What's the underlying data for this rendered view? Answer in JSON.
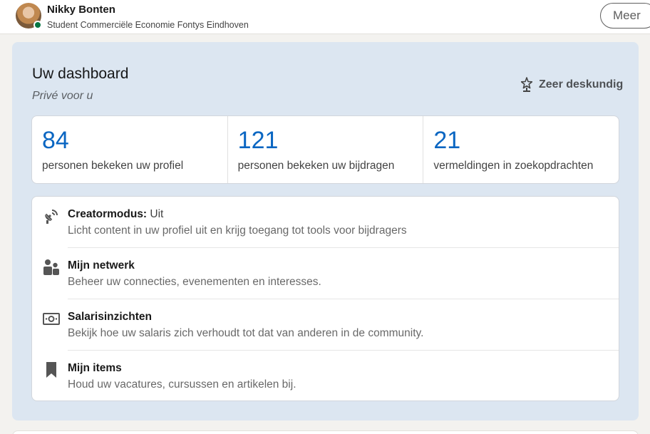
{
  "profile": {
    "name": "Nikky Bonten",
    "headline": "Student Commerciële Economie Fontys Eindhoven",
    "more_label": "Meer"
  },
  "dashboard": {
    "title": "Uw dashboard",
    "subtitle": "Privé voor u",
    "expert_label": "Zeer deskundig",
    "stats": [
      {
        "value": "84",
        "label": "personen bekeken uw profiel"
      },
      {
        "value": "121",
        "label": "personen bekeken uw bijdragen"
      },
      {
        "value": "21",
        "label": "vermeldingen in zoekopdrachten"
      }
    ],
    "resources": [
      {
        "icon": "satellite-dish-icon",
        "title": "Creatormodus:",
        "status": " Uit",
        "description": "Licht content in uw profiel uit en krijg toegang tot tools voor bijdragers"
      },
      {
        "icon": "people-icon",
        "title": "Mijn netwerk",
        "description": "Beheer uw connecties, evenementen en interesses."
      },
      {
        "icon": "money-bill-icon",
        "title": "Salarisinzichten",
        "description": "Bekijk hoe uw salaris zich verhoudt tot dat van anderen in de community."
      },
      {
        "icon": "bookmark-icon",
        "title": "Mijn items",
        "description": "Houd uw vacatures, cursussen en artikelen bij."
      }
    ]
  },
  "colors": {
    "accent": "#0a66c2",
    "dashboard_bg": "#dce6f1",
    "presence": "#057642"
  }
}
